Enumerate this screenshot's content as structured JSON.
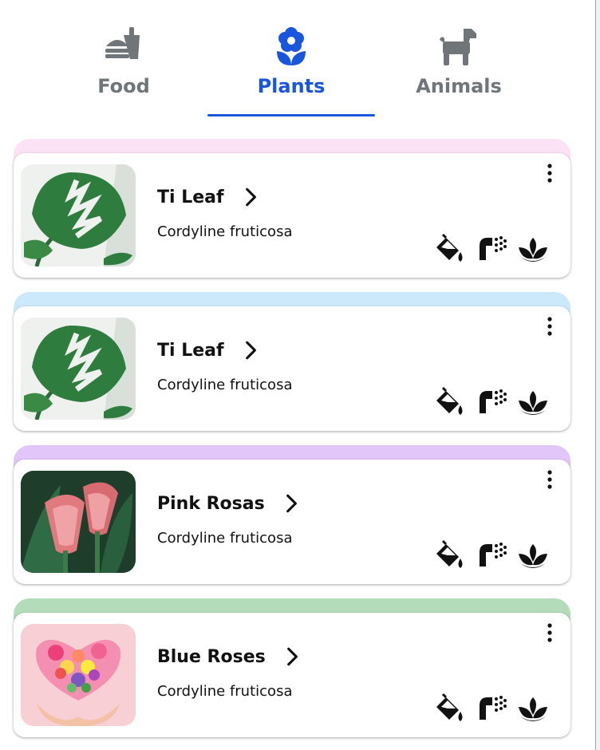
{
  "tabs": [
    {
      "label": "Food",
      "icon": "fastfood-icon",
      "active": false
    },
    {
      "label": "Plants",
      "icon": "flower-icon",
      "active": true
    },
    {
      "label": "Animals",
      "icon": "dog-icon",
      "active": false
    }
  ],
  "colors": {
    "active": "#1a56db",
    "inactive": "#70757a",
    "accents": [
      "#fbe3f5",
      "#cce9fb",
      "#e2c6fa",
      "#b3dcbb"
    ]
  },
  "cards": [
    {
      "title": "Ti Leaf",
      "subtitle": "Cordyline fruticosa",
      "image": "monstera-leaf-photo",
      "accent": "#fbe3f5"
    },
    {
      "title": "Ti Leaf",
      "subtitle": "Cordyline fruticosa",
      "image": "monstera-leaf-photo",
      "accent": "#cce9fb"
    },
    {
      "title": "Pink Rosas",
      "subtitle": "Cordyline fruticosa",
      "image": "pink-calla-lily-photo",
      "accent": "#e2c6fa"
    },
    {
      "title": "Blue Roses",
      "subtitle": "Cordyline fruticosa",
      "image": "flower-heart-bouquet-photo",
      "accent": "#b3dcbb"
    }
  ],
  "card_icons": [
    "fertilize-bucket-icon",
    "water-spray-icon",
    "plant-care-lotus-icon"
  ],
  "menu_icon": "more-vert-icon",
  "title_icon": "chevron-right-icon"
}
